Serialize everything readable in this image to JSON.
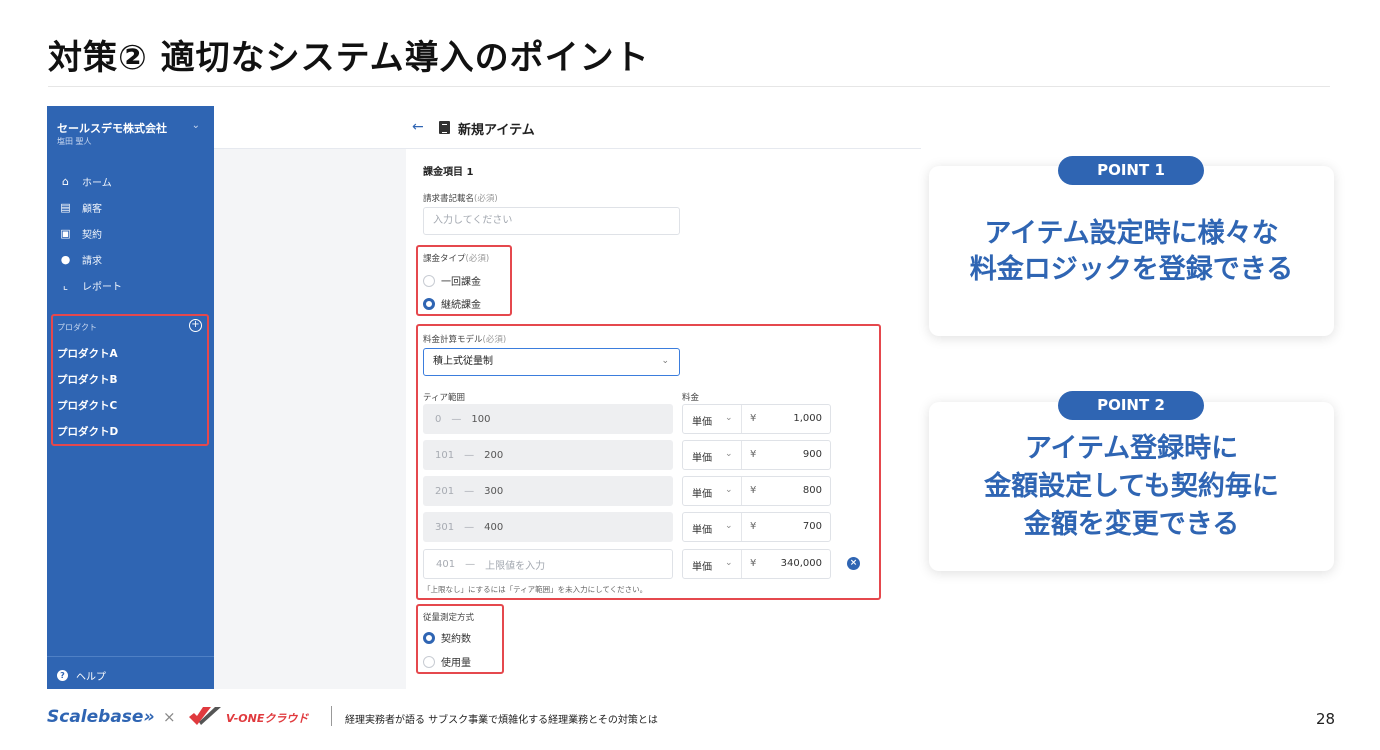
{
  "slide": {
    "title": "対策② 適切なシステム導入のポイント",
    "page_number": "28",
    "footer_text": "経理実務者が語る サブスク事業で煩雑化する経理業務とその対策とは",
    "logos": {
      "scalebase": "Scalebase»",
      "separator": "×",
      "vone": "V-ONEクラウド"
    }
  },
  "sidebar": {
    "company": "セールスデモ株式会社",
    "company_sub": "塩田 聖人",
    "nav": [
      {
        "label": "ホーム",
        "icon": "home-icon"
      },
      {
        "label": "顧客",
        "icon": "customer-icon"
      },
      {
        "label": "契約",
        "icon": "contract-icon"
      },
      {
        "label": "請求",
        "icon": "billing-icon"
      },
      {
        "label": "レポート",
        "icon": "report-icon"
      }
    ],
    "products_header": "プロダクト",
    "products": [
      "プロダクトA",
      "プロダクトB",
      "プロダクトC",
      "プロダクトD"
    ],
    "help": "ヘルプ"
  },
  "form": {
    "title": "新規アイテム",
    "section": "課金項目 1",
    "invoice_name_label": "請求書記載名",
    "required": "(必須)",
    "invoice_name_placeholder": "入力してください",
    "billing_type_label": "課金タイプ",
    "billing_type_options": [
      "一回課金",
      "継続課金"
    ],
    "billing_type_selected": "継続課金",
    "calc_model_label": "料金計算モデル",
    "calc_model_value": "積上式従量制",
    "tier_header": "ティア範囲",
    "price_header": "料金",
    "tiers": [
      {
        "from": "0",
        "to": "100",
        "unit": "単価",
        "currency": "¥",
        "amount": "1,000"
      },
      {
        "from": "101",
        "to": "200",
        "unit": "単価",
        "currency": "¥",
        "amount": "900"
      },
      {
        "from": "201",
        "to": "300",
        "unit": "単価",
        "currency": "¥",
        "amount": "800"
      },
      {
        "from": "301",
        "to": "400",
        "unit": "単価",
        "currency": "¥",
        "amount": "700"
      },
      {
        "from": "401",
        "to": "上限値を入力",
        "unit": "単価",
        "currency": "¥",
        "amount": "340,000"
      }
    ],
    "tier_note": "「上限なし」にするには「ティア範囲」を未入力にしてください。",
    "measure_label": "従量測定方式",
    "measure_options": [
      "契約数",
      "使用量"
    ],
    "measure_selected": "契約数"
  },
  "points": [
    {
      "badge": "POINT 1",
      "lines": [
        "アイテム設定時に様々な",
        "料金ロジックを登録できる"
      ]
    },
    {
      "badge": "POINT 2",
      "lines": [
        "アイテム登録時に",
        "金額設定しても契約毎に",
        "金額を変更できる"
      ]
    }
  ],
  "colors": {
    "brand_blue": "#2f65b3",
    "highlight_red": "#e5484d"
  }
}
